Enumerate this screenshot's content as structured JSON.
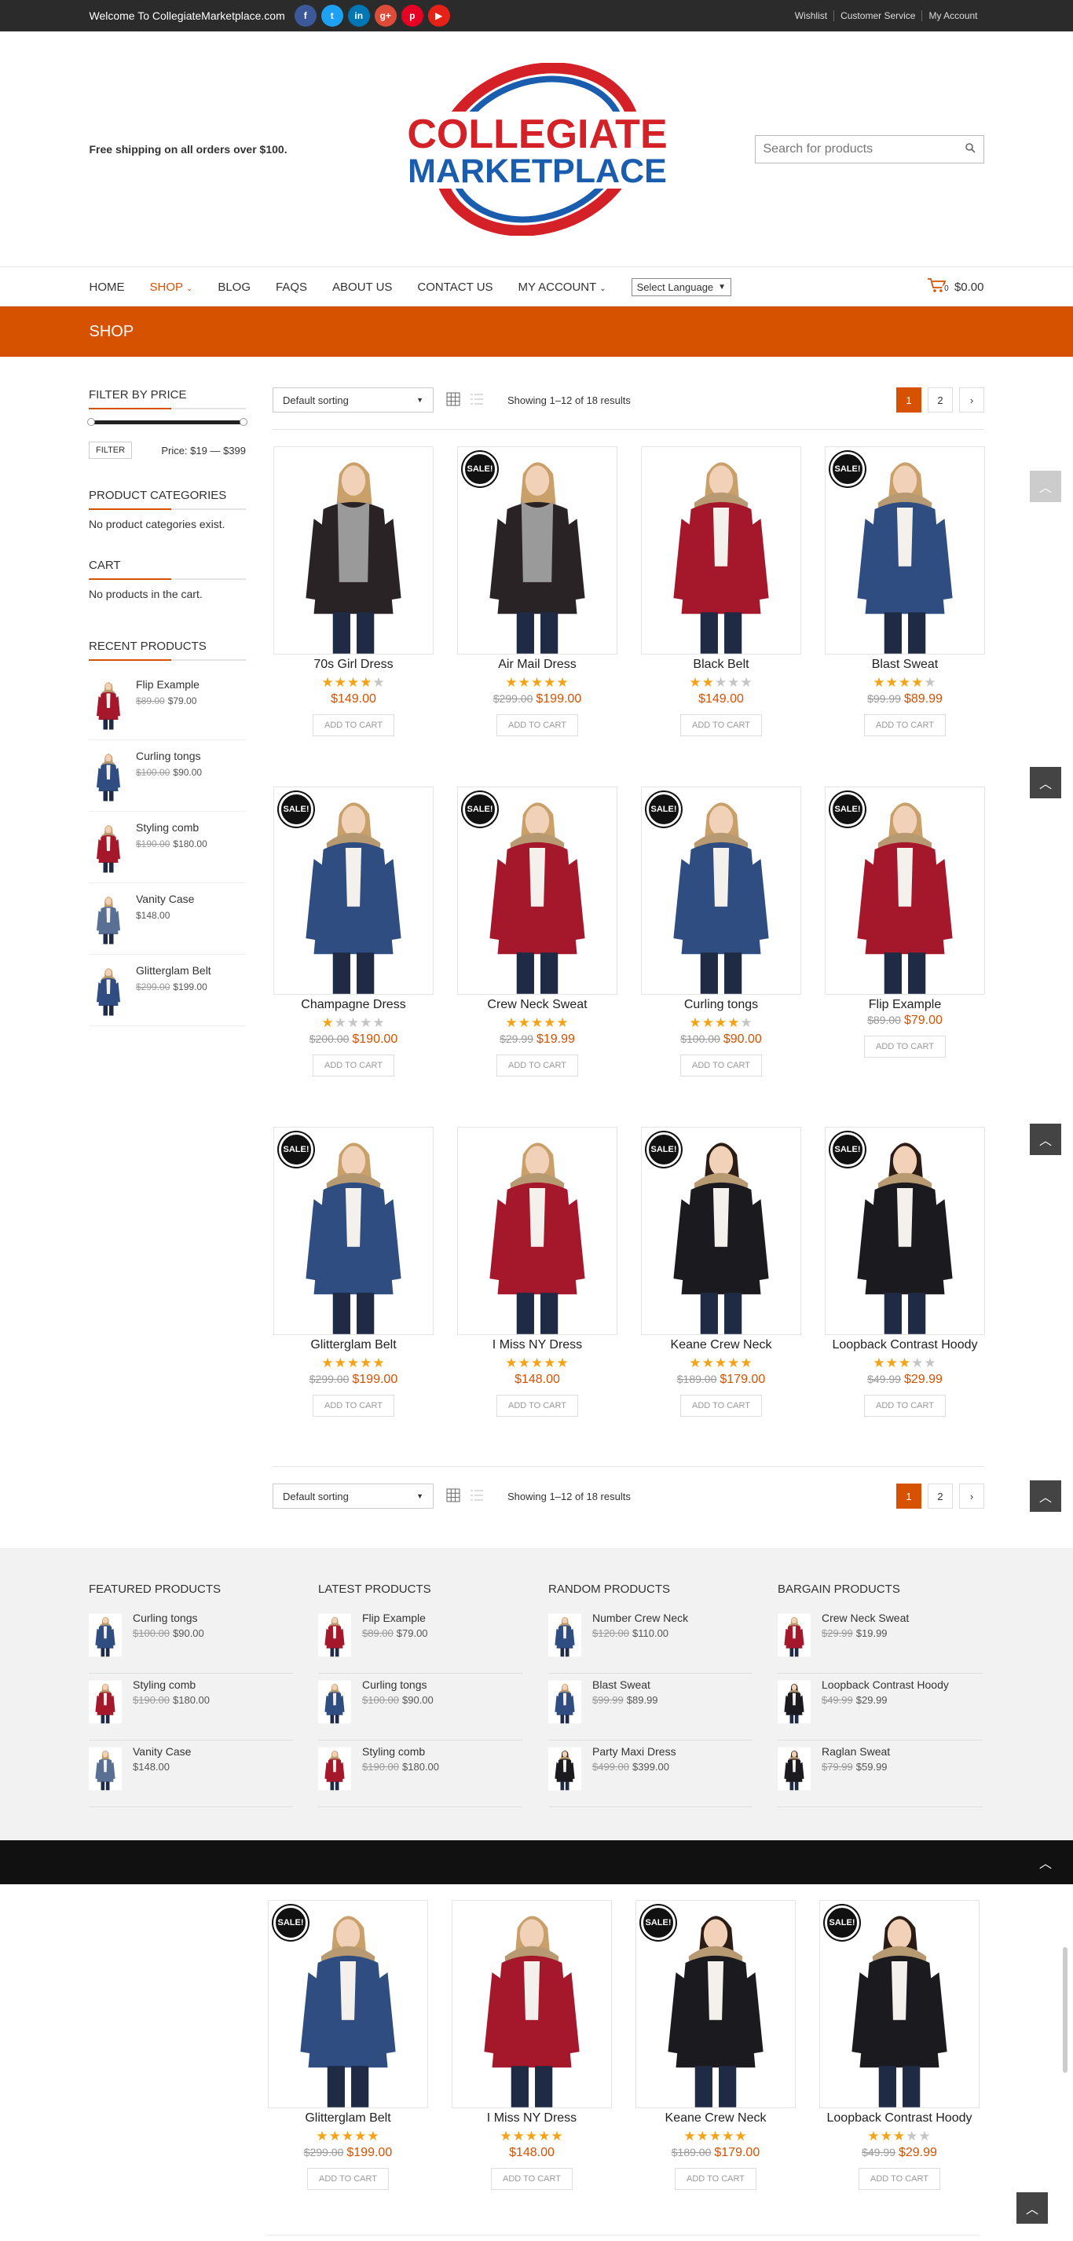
{
  "topbar": {
    "welcome": "Welcome To CollegiateMarketplace.com",
    "social": [
      {
        "icon": "facebook-icon",
        "glyph": "f",
        "color": "#3b5998"
      },
      {
        "icon": "twitter-icon",
        "glyph": "t",
        "color": "#1da1f2"
      },
      {
        "icon": "linkedin-icon",
        "glyph": "in",
        "color": "#0077b5"
      },
      {
        "icon": "google-plus-icon",
        "glyph": "g+",
        "color": "#dd4b39"
      },
      {
        "icon": "pinterest-icon",
        "glyph": "p",
        "color": "#e60023"
      },
      {
        "icon": "youtube-icon",
        "glyph": "▶",
        "color": "#e62117"
      }
    ],
    "links": [
      "Wishlist",
      "Customer Service",
      "My Account"
    ]
  },
  "header": {
    "free_shipping": "Free shipping on all orders over $100.",
    "logo_line1": "COLLEGIATE",
    "logo_line2": "MARKETPLACE",
    "search_placeholder": "Search for products"
  },
  "nav": {
    "items": [
      "HOME",
      "SHOP",
      "BLOG",
      "FAQS",
      "ABOUT US",
      "CONTACT US",
      "MY ACCOUNT"
    ],
    "language": "Select Language",
    "cart_count": "0",
    "cart_total": "$0.00"
  },
  "banner": {
    "title": "SHOP"
  },
  "sidebar": {
    "filter_title": "FILTER BY PRICE",
    "filter_button": "FILTER",
    "price_range": "Price: $19 — $399",
    "categories_title": "PRODUCT CATEGORIES",
    "categories_empty": "No product categories exist.",
    "cart_title": "CART",
    "cart_empty": "No products in the cart.",
    "recent_title": "RECENT PRODUCTS",
    "recent": [
      {
        "name": "Flip Example",
        "old": "$89.00",
        "price": "$79.00",
        "coat": "red"
      },
      {
        "name": "Curling tongs",
        "old": "$100.00",
        "price": "$90.00",
        "coat": "blue"
      },
      {
        "name": "Styling comb",
        "old": "$190.00",
        "price": "$180.00",
        "coat": "red"
      },
      {
        "name": "Vanity Case",
        "old": "",
        "price": "$148.00",
        "coat": "denim"
      },
      {
        "name": "Glitterglam Belt",
        "old": "$299.00",
        "price": "$199.00",
        "coat": "blue"
      }
    ]
  },
  "toolbar": {
    "sort": "Default sorting",
    "results": "Showing 1–12 of 18 results",
    "pages": [
      "1",
      "2",
      "›"
    ]
  },
  "products": [
    {
      "title": "70s Girl Dress",
      "rating": 4,
      "old": "",
      "price": "$149.00",
      "sale": false,
      "coat": "black-scarf"
    },
    {
      "title": "Air Mail Dress",
      "rating": 5,
      "old": "$299.00",
      "price": "$199.00",
      "sale": true,
      "coat": "black-scarf"
    },
    {
      "title": "Black Belt",
      "rating": 2,
      "old": "",
      "price": "$149.00",
      "sale": false,
      "coat": "red"
    },
    {
      "title": "Blast Sweat",
      "rating": 4,
      "old": "$99.99",
      "price": "$89.99",
      "sale": true,
      "coat": "blue"
    },
    {
      "title": "Champagne Dress",
      "rating": 1,
      "old": "$200.00",
      "price": "$190.00",
      "sale": true,
      "coat": "blue"
    },
    {
      "title": "Crew Neck Sweat",
      "rating": 5,
      "old": "$29.99",
      "price": "$19.99",
      "sale": true,
      "coat": "red"
    },
    {
      "title": "Curling tongs",
      "rating": 4,
      "old": "$100.00",
      "price": "$90.00",
      "sale": true,
      "coat": "blue"
    },
    {
      "title": "Flip Example",
      "rating": 0,
      "old": "$89.00",
      "price": "$79.00",
      "sale": true,
      "coat": "red"
    },
    {
      "title": "Glitterglam Belt",
      "rating": 5,
      "old": "$299.00",
      "price": "$199.00",
      "sale": true,
      "coat": "blue"
    },
    {
      "title": "I Miss NY Dress",
      "rating": 5,
      "old": "",
      "price": "$148.00",
      "sale": false,
      "coat": "red"
    },
    {
      "title": "Keane Crew Neck",
      "rating": 5,
      "old": "$189.00",
      "price": "$179.00",
      "sale": true,
      "coat": "black"
    },
    {
      "title": "Loopback Contrast Hoody",
      "rating": 3,
      "old": "$49.99",
      "price": "$29.99",
      "sale": true,
      "coat": "black"
    }
  ],
  "card_labels": {
    "sale": "SALE!",
    "add_to_cart": "ADD TO CART"
  },
  "footer": {
    "columns": [
      {
        "title": "FEATURED PRODUCTS",
        "items": [
          {
            "name": "Curling tongs",
            "old": "$100.00",
            "price": "$90.00",
            "coat": "blue"
          },
          {
            "name": "Styling comb",
            "old": "$190.00",
            "price": "$180.00",
            "coat": "red"
          },
          {
            "name": "Vanity Case",
            "old": "",
            "price": "$148.00",
            "coat": "denim"
          }
        ]
      },
      {
        "title": "LATEST PRODUCTS",
        "items": [
          {
            "name": "Flip Example",
            "old": "$89.00",
            "price": "$79.00",
            "coat": "red"
          },
          {
            "name": "Curling tongs",
            "old": "$100.00",
            "price": "$90.00",
            "coat": "blue"
          },
          {
            "name": "Styling comb",
            "old": "$190.00",
            "price": "$180.00",
            "coat": "red"
          }
        ]
      },
      {
        "title": "RANDOM PRODUCTS",
        "items": [
          {
            "name": "Number Crew Neck",
            "old": "$120.00",
            "price": "$110.00",
            "coat": "blue"
          },
          {
            "name": "Blast Sweat",
            "old": "$99.99",
            "price": "$89.99",
            "coat": "blue"
          },
          {
            "name": "Party Maxi Dress",
            "old": "$499.00",
            "price": "$399.00",
            "coat": "black"
          }
        ]
      },
      {
        "title": "BARGAIN PRODUCTS",
        "items": [
          {
            "name": "Crew Neck Sweat",
            "old": "$29.99",
            "price": "$19.99",
            "coat": "red"
          },
          {
            "name": "Loopback Contrast Hoody",
            "old": "$49.99",
            "price": "$29.99",
            "coat": "black"
          },
          {
            "name": "Raglan Sweat",
            "old": "$79.99",
            "price": "$59.99",
            "coat": "black"
          }
        ]
      }
    ]
  },
  "colors": {
    "accent": "#d65100",
    "star": "#f5a316",
    "dark": "#2b2b2b"
  }
}
